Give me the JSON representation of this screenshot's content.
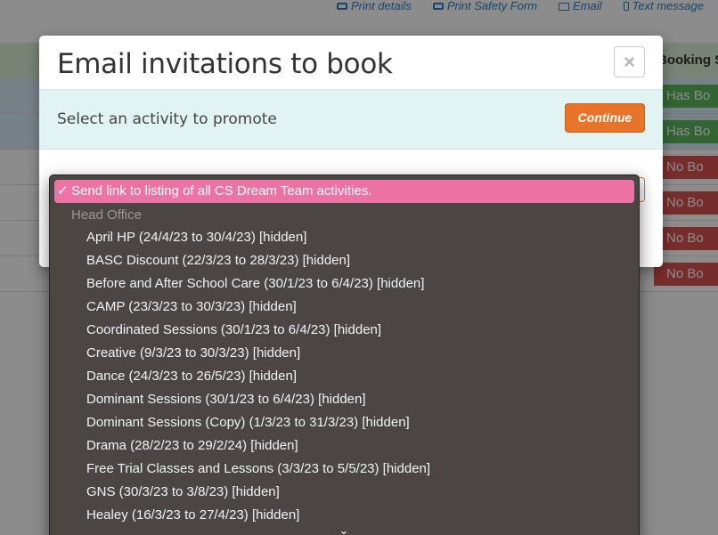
{
  "background": {
    "top_links": [
      {
        "label": "Print details",
        "icon": "print-icon"
      },
      {
        "label": "Print Safety Form",
        "icon": "print-icon"
      },
      {
        "label": "Email",
        "icon": "envelope-icon"
      },
      {
        "label": "Text message",
        "icon": "phone-icon"
      }
    ],
    "column_header": "Booking St",
    "status_badges": [
      "Has Bo",
      "Has Bo",
      "No Bo",
      "No Bo",
      "No Bo",
      "No Bo"
    ]
  },
  "modal": {
    "title": "Email invitations to book",
    "close_icon": "×",
    "prompt": "Select an activity to promote",
    "continue_label": "Continue"
  },
  "dropdown": {
    "selected_check": "✓",
    "selected_label": "Send link to listing of all CS Dream Team activities.",
    "group_label": "Head Office",
    "options": [
      "April HP (24/4/23 to 30/4/23) [hidden]",
      "BASC Discount (22/3/23 to 28/3/23) [hidden]",
      "Before and After School Care (30/1/23 to 6/4/23) [hidden]",
      "CAMP (23/3/23 to 30/3/23) [hidden]",
      "Coordinated Sessions (30/1/23 to 6/4/23) [hidden]",
      "Creative (9/3/23 to 30/3/23) [hidden]",
      "Dance (24/3/23 to 26/5/23) [hidden]",
      "Dominant Sessions (30/1/23 to 6/4/23) [hidden]",
      "Dominant Sessions (Copy) (1/3/23 to 31/3/23) [hidden]",
      "Drama (28/2/23 to 29/2/24) [hidden]",
      "Free Trial Classes and Lessons (3/3/23 to 5/5/23) [hidden]",
      "GNS (30/3/23 to 3/8/23) [hidden]",
      "Healey (16/3/23 to 27/4/23) [hidden]"
    ],
    "scroll_more_glyph": "⌄"
  }
}
